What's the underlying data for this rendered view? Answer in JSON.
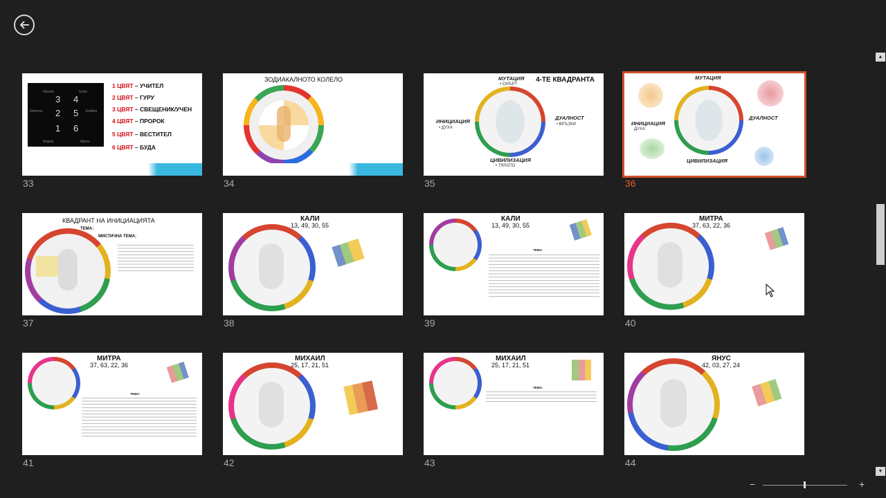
{
  "nav": {
    "back_icon": "back-arrow-icon"
  },
  "slides": [
    {
      "number": "33",
      "selected": false,
      "items": [
        {
          "num": "1 ЦВЯТ",
          "text": " – УЧИТЕЛ"
        },
        {
          "num": "2 ЦВЯТ",
          "text": " – ГУРУ"
        },
        {
          "num": "3 ЦВЯТ",
          "text": " – СВЕЩЕНИК/УЧЕН"
        },
        {
          "num": "4 ЦВЯТ",
          "text": " – ПРОРОК"
        },
        {
          "num": "5 ЦВЯТ",
          "text": " – ВЕСТИТЕЛ"
        },
        {
          "num": "6 ЦВЯТ",
          "text": " – БУДА"
        }
      ],
      "grid_digits": [
        "3",
        "4",
        "2",
        "5",
        "1",
        "6"
      ],
      "grid_labels": [
        "Ghosts",
        "Gods",
        "Demons",
        "Entities",
        "Angels",
        "Aliens"
      ]
    },
    {
      "number": "34",
      "title": "ЗОДИАКАЛНОТО КОЛЕЛО"
    },
    {
      "number": "35",
      "title": "4-ТЕ КВАДРАНТА",
      "quadrants": {
        "top": "МУТАЦИЯ",
        "top_sub": "• СМЪРТ",
        "left": "ИНИЦИАЦИЯ",
        "left_sub": "• ДУХА",
        "right": "ДУАЛНОСТ",
        "right_sub": "• ВРЪЗКИ",
        "bottom": "ЦИВИЛИЗАЦИЯ",
        "bottom_sub": "• ТЯЛОТО"
      }
    },
    {
      "number": "36",
      "selected": true,
      "quadrants": {
        "top": "МУТАЦИЯ",
        "left": "ИНИЦИАЦИЯ",
        "left_sub": "ДУХА",
        "right": "ДУАЛНОСТ",
        "bottom": "ЦИВИЛИЗАЦИЯ"
      }
    },
    {
      "number": "37",
      "title": "КВАДРАНТ НА ИНИЦИАЦИЯТА",
      "theme_label": "ТЕМА:",
      "mystic_label": "МИСТИЧНА ТЕМА:"
    },
    {
      "number": "38",
      "title": "КАЛИ",
      "gates": "13, 49, 30, 55"
    },
    {
      "number": "39",
      "title": "КАЛИ",
      "gates": "13, 49, 30, 55",
      "theme_label": "ТЕМА:"
    },
    {
      "number": "40",
      "title": "МИТРА",
      "gates": "37, 63, 22, 36"
    },
    {
      "number": "41",
      "title": "МИТРА",
      "gates": "37, 63, 22, 36",
      "theme_label": "ТЕМА:"
    },
    {
      "number": "42",
      "title": "МИХАИЛ",
      "gates": "25, 17, 21, 51"
    },
    {
      "number": "43",
      "title": "МИХАИЛ",
      "gates": "25, 17, 21, 51",
      "theme_label": "ТЕМА:"
    },
    {
      "number": "44",
      "title": "ЯНУС",
      "gates": "42, 03, 27, 24"
    }
  ],
  "scrollbar": {
    "up_icon": "scroll-up-arrow-icon",
    "down_icon": "scroll-down-arrow-icon"
  },
  "zoom": {
    "minus": "−",
    "plus": "+",
    "level": 0.48
  },
  "colors": {
    "background": "#1f1f1f",
    "selection": "#d0502a",
    "accent_red": "#d4111a",
    "cyan": "#39b8e0"
  }
}
